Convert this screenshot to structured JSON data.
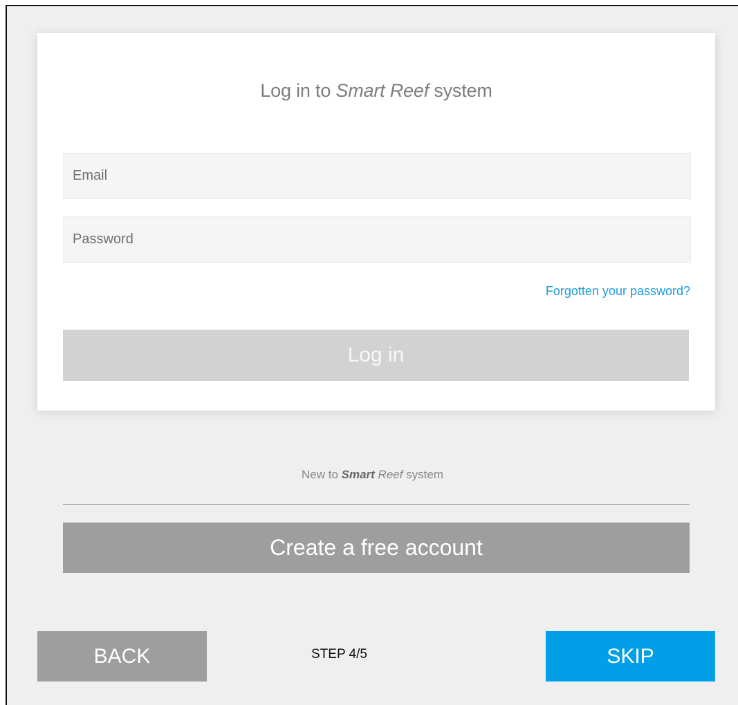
{
  "login_card": {
    "title_prefix": "Log in to ",
    "title_brand": "Smart Reef",
    "title_suffix": " system",
    "email_placeholder": "Email",
    "password_placeholder": "Password",
    "forgot_password_link": "Forgotten your password?",
    "login_button_label": "Log in"
  },
  "signup": {
    "prefix": "New to ",
    "brand_strong": "Smart",
    "brand_light": " Reef",
    "suffix": " system",
    "create_account_label": "Create a free account"
  },
  "footer": {
    "back_label": "BACK",
    "step_label": "STEP 4/5",
    "skip_label": "SKIP"
  },
  "colors": {
    "background": "#efefef",
    "link": "#1e9be0",
    "skip_button": "#009fe8",
    "login_button_disabled": "#d2d2d2",
    "secondary_button": "#9e9e9e"
  }
}
